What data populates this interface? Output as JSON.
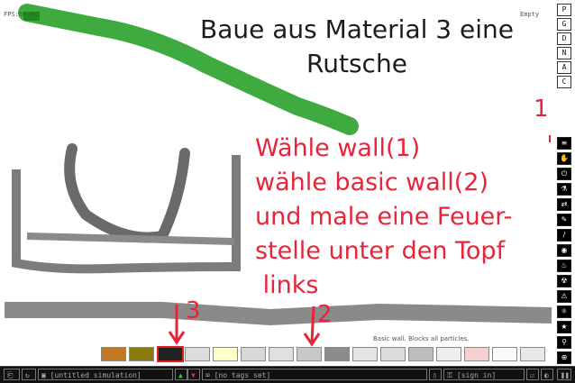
{
  "status": {
    "fps": "FPS:60.47",
    "sim_info": "Empty"
  },
  "canvas": {
    "title_line1": "Baue aus Material 3 eine",
    "title_line2": "Rutsche",
    "instructions": [
      "Wähle wall(1)",
      "wähle basic wall(2)",
      "und male eine Feuer-",
      "stelle unter den Topf",
      " links"
    ],
    "marker_1": "1",
    "marker_2": "2",
    "marker_3": "3",
    "element_legend": "Basic wall. Blocks all particles."
  },
  "menu_top": [
    "P",
    "G",
    "D",
    "N",
    "A",
    "C"
  ],
  "categories": [
    "≡",
    "✋",
    "⏻",
    "⚗",
    "⇄",
    "✎",
    "/",
    "◉",
    "♨",
    "☢",
    "⚠",
    "⚛",
    "★",
    "⚲",
    "⊕",
    "≋"
  ],
  "palette": {
    "colors": [
      "#c07a20",
      "#8a7a10",
      "#222222",
      "#dddddd",
      "#ffffc8",
      "#d8d8d8",
      "#e0e0e0",
      "#c8c8c8",
      "#8c8c8c",
      "#e4e4e4",
      "#dcdcdc",
      "#bcbcbc",
      "#eeeeee",
      "#f4d0d0",
      "#fafafa",
      "#e8e8e8"
    ],
    "selected_index": 2
  },
  "bottom_bar": {
    "simulation_name": "[untitled simulation]",
    "tags": "[no tags set]",
    "sign_in": "[sign in]"
  },
  "colors": {
    "accent_red": "#e8243a",
    "green_stroke": "#2aa12a",
    "wall_gray": "#7a7a7a"
  }
}
